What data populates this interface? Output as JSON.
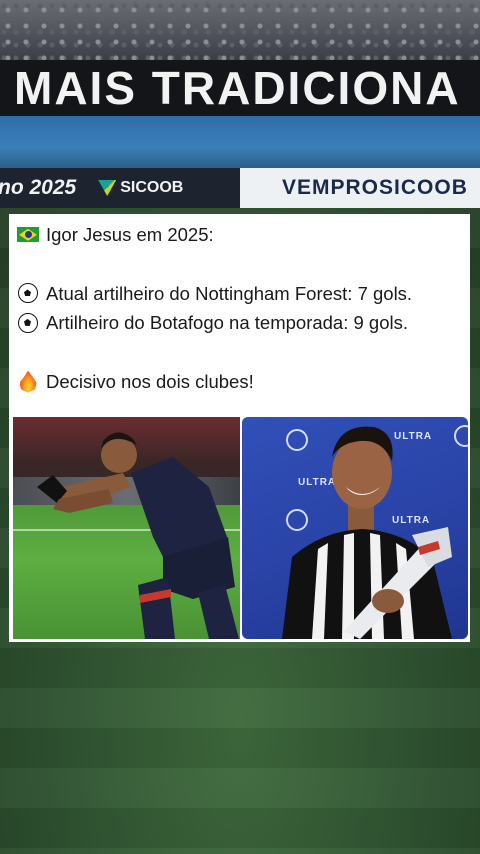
{
  "background": {
    "banner_text": "MAIS TRADICIONA",
    "ad_board": {
      "left_year": "no 2025",
      "brand": "SICOOB",
      "right_text": "VEMPROSICOOB"
    }
  },
  "post": {
    "lines": [
      {
        "icon": "brazil-flag-icon",
        "text": "Igor Jesus em 2025:"
      },
      {
        "icon": "soccer-ball-icon",
        "text": "Atual artilheiro do Nottingham Forest: 7 gols."
      },
      {
        "icon": "soccer-ball-icon",
        "text": "Artilheiro do Botafogo na temporada: 9 gols."
      },
      {
        "icon": "fire-icon",
        "text": "Decisivo nos dois clubes!"
      }
    ]
  },
  "photos": {
    "left": {
      "subject": "player-celebrating"
    },
    "right": {
      "subject": "player-with-trophy",
      "backdrop_text": "ULTRA",
      "colors": {
        "backdrop": "#2a44a8"
      }
    }
  }
}
